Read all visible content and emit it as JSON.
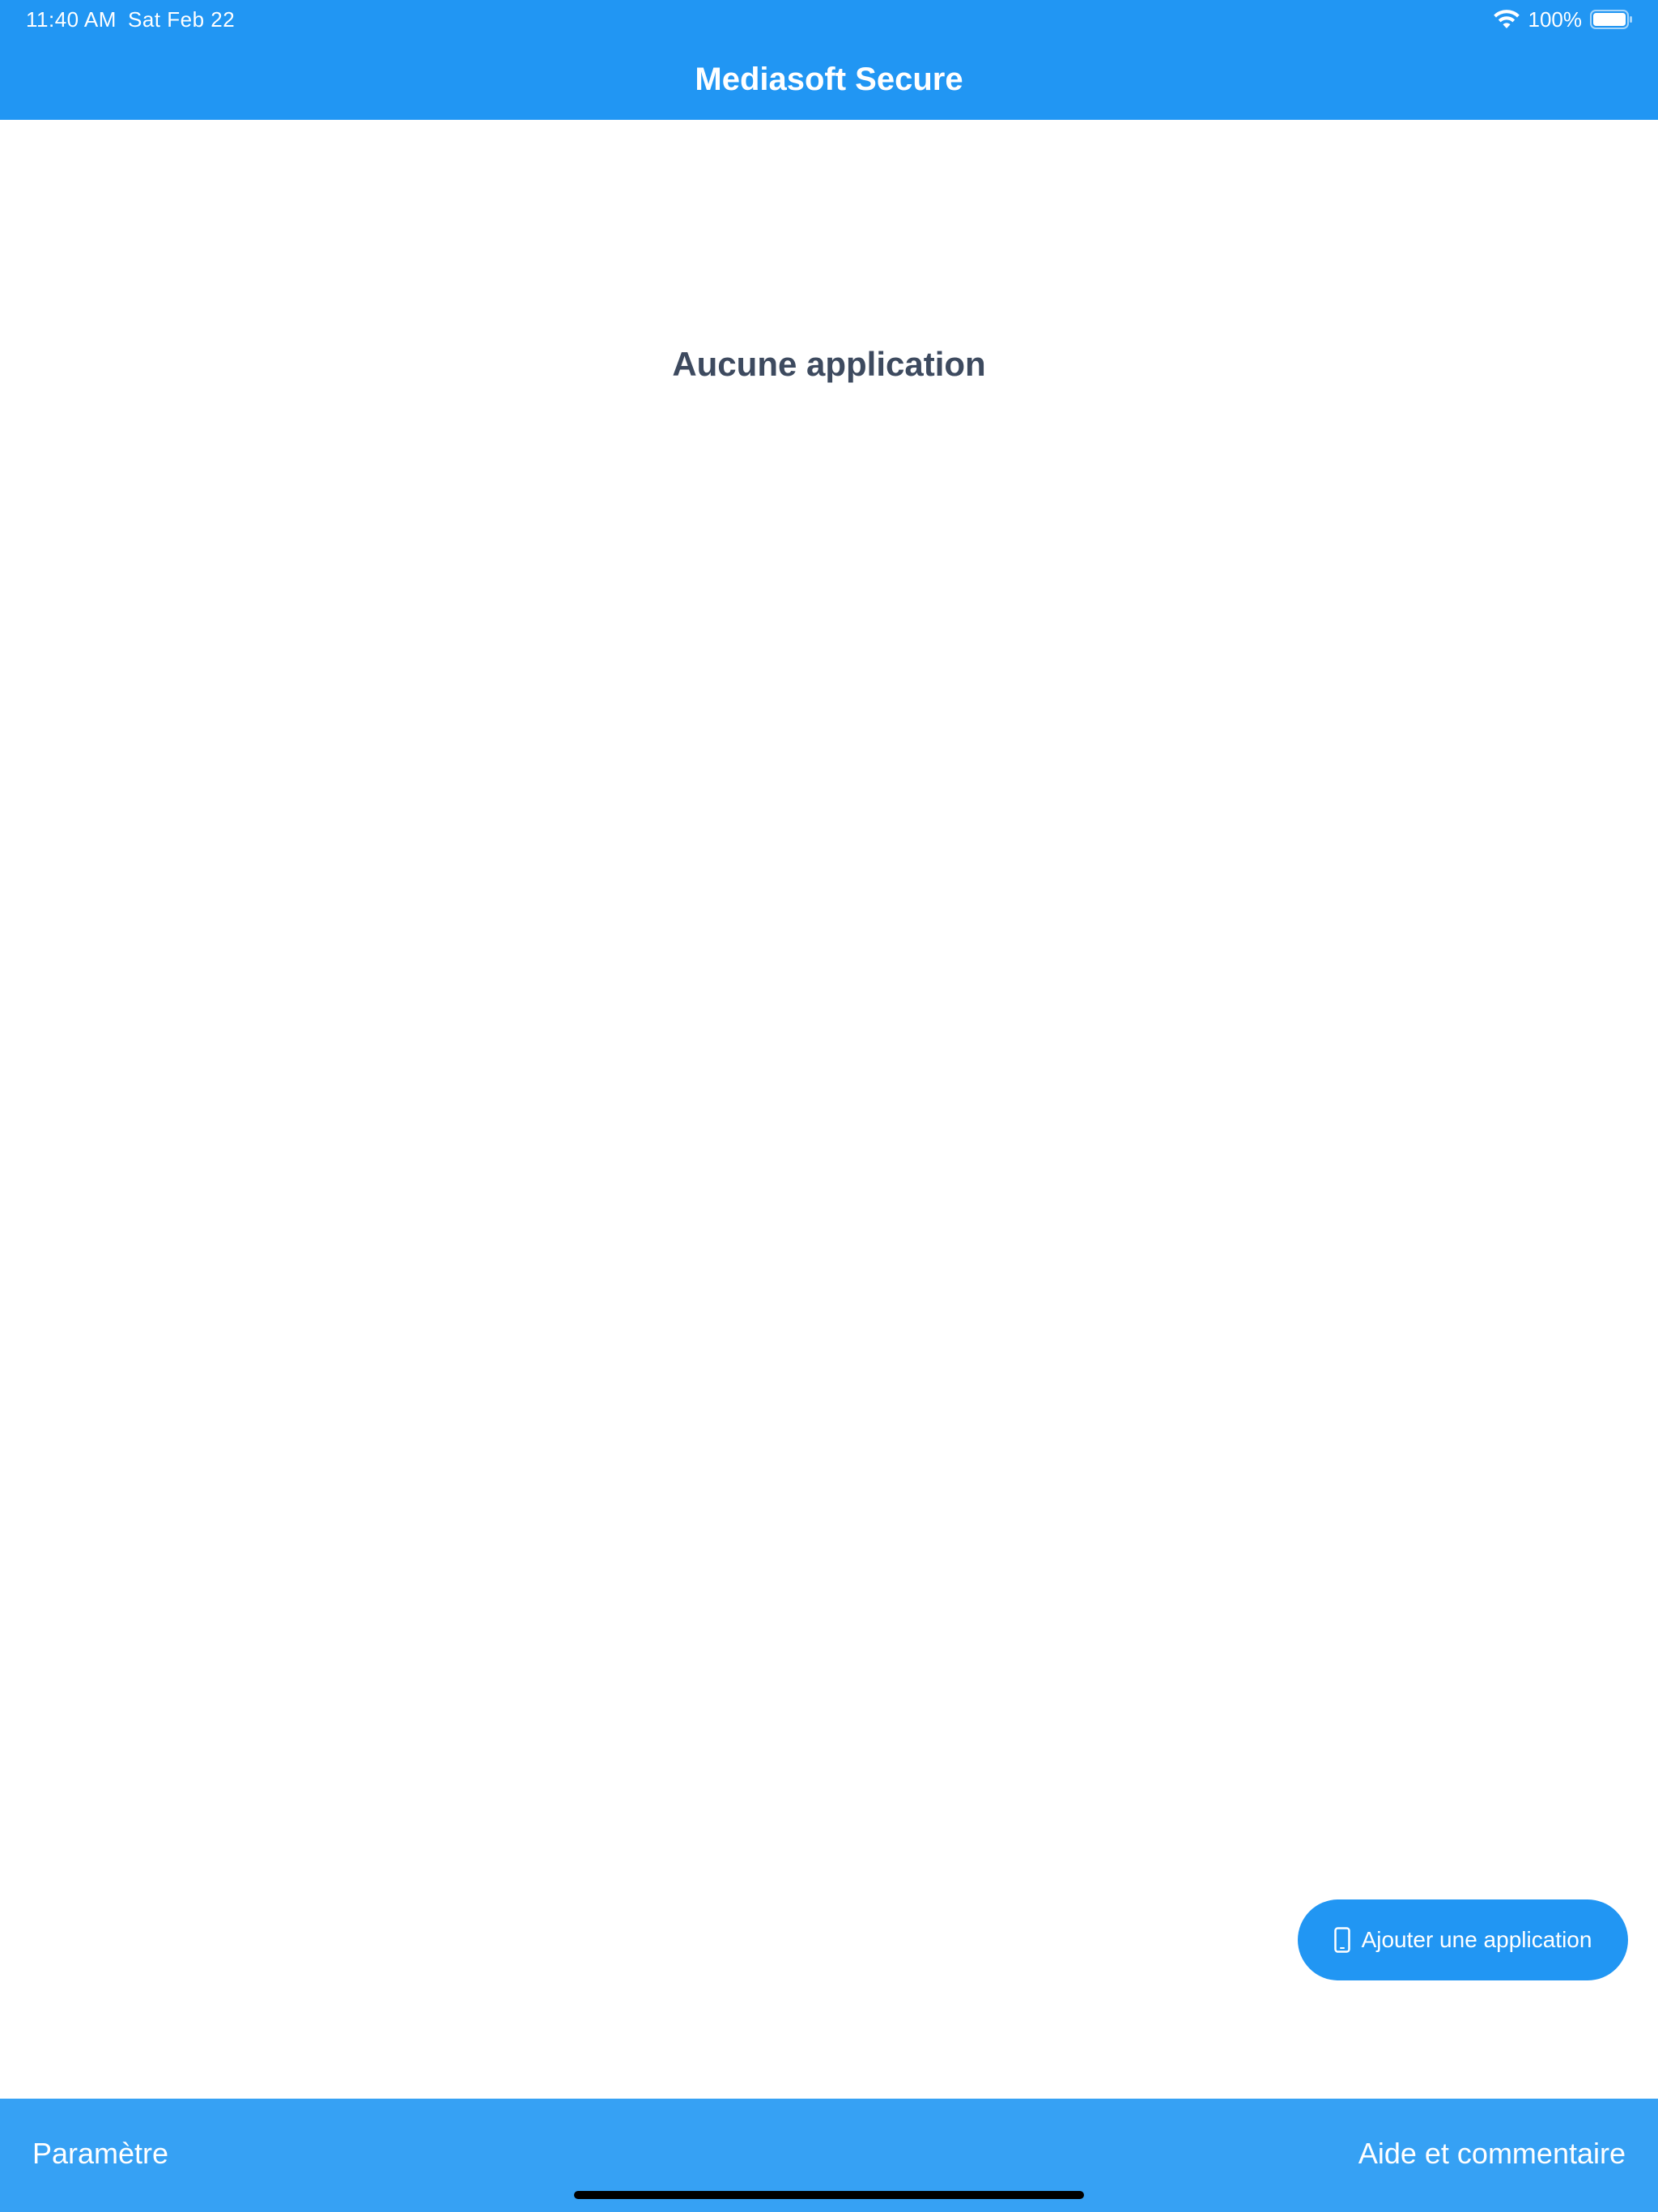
{
  "status_bar": {
    "time": "11:40 AM",
    "date": "Sat Feb 22",
    "battery_percent": "100%",
    "wifi_icon": "wifi-icon",
    "battery_icon": "battery-full-icon"
  },
  "header": {
    "title": "Mediasoft Secure"
  },
  "main": {
    "empty_message": "Aucune application"
  },
  "fab": {
    "icon": "smartphone-icon",
    "label": "Ajouter une application"
  },
  "bottom_bar": {
    "left_label": "Paramètre",
    "right_label": "Aide et commentaire"
  },
  "colors": {
    "primary": "#2196f3",
    "bottom_bar": "#36a1f4",
    "empty_text": "#3d4a5f",
    "background": "#ffffff"
  }
}
